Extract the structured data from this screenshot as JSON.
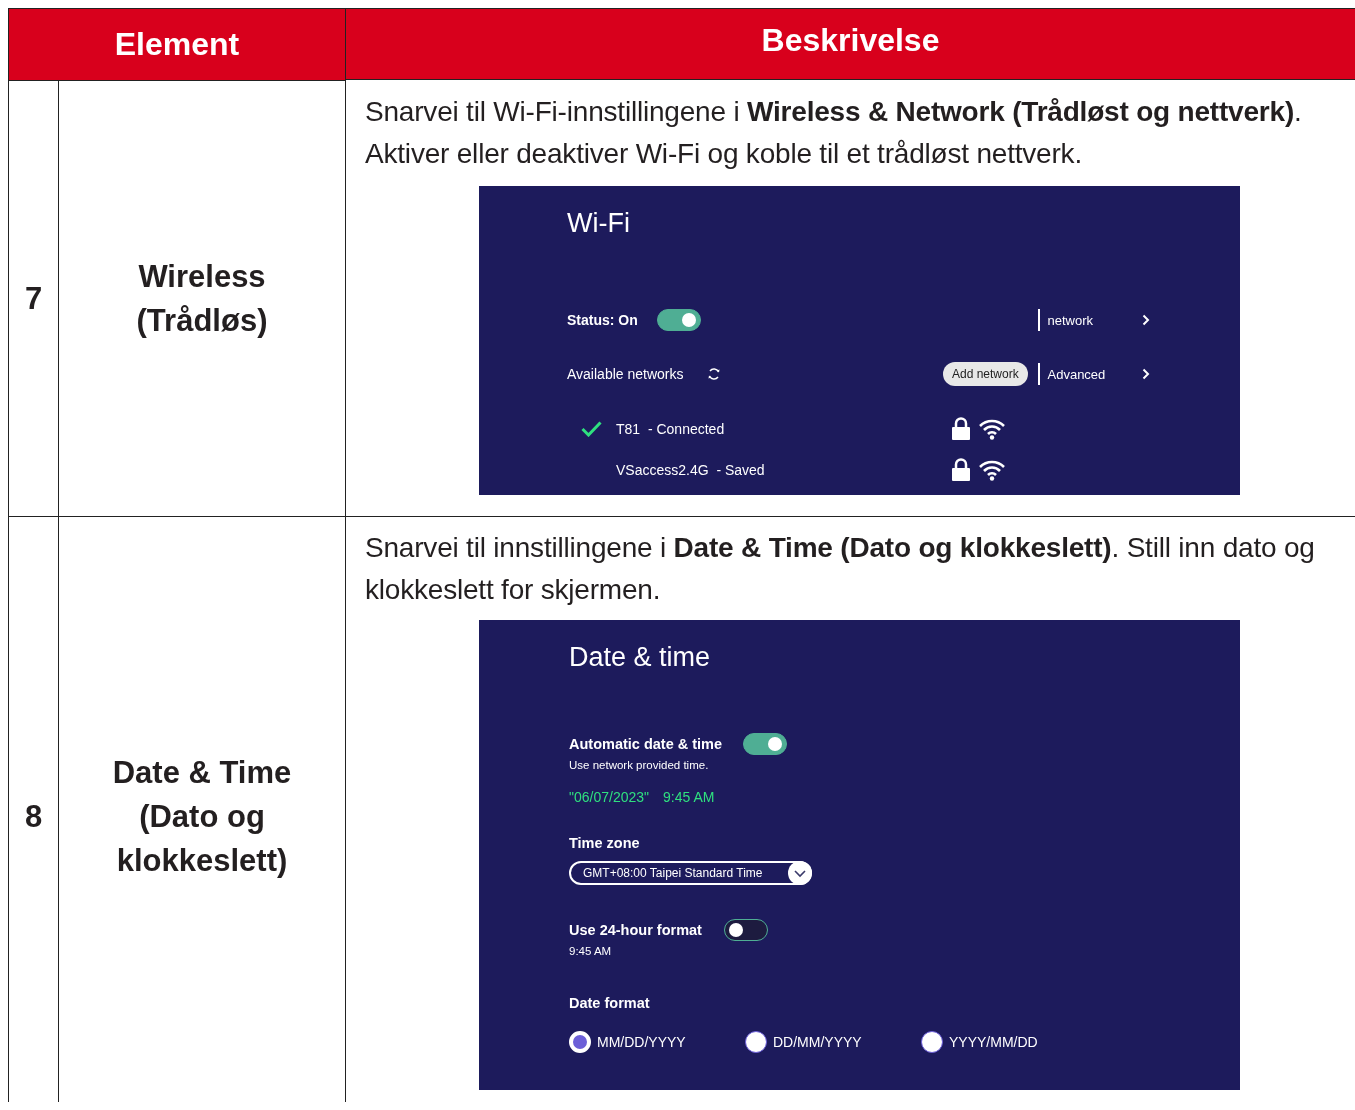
{
  "table": {
    "columns": [
      "Element",
      "Beskrivelse"
    ],
    "rows": [
      {
        "number": "7",
        "element_lines": [
          "Wireless",
          "(Trådløs)"
        ],
        "description": "Snarvei til Wi-Fi-innstillingene i **Wireless & Network (Trådløst og nettverk)**. Aktiver eller deaktiver Wi-Fi og koble til et trådløst nettverk.",
        "screen": {
          "kind": "wifi",
          "title": "Wi-Fi",
          "status_label": "Status: On",
          "status_on": true,
          "available_label": "Available networks",
          "add_button": "Add network",
          "side_links": [
            "network",
            "Advanced"
          ],
          "networks": [
            {
              "name": "T81",
              "state": "- Connected",
              "connected": true
            },
            {
              "name": "VSaccess2.4G",
              "state": "- Saved",
              "connected": false
            }
          ]
        }
      },
      {
        "number": "8",
        "element_lines": [
          "Date & Time",
          "(Dato og",
          "klokkeslett)"
        ],
        "description": "Snarvei til innstillingene i **Date & Time (Dato og klokkeslett)**. Still inn dato og klokkeslett for skjermen.",
        "screen": {
          "kind": "datetime",
          "title": "Date & time",
          "auto_label": "Automatic date & time",
          "auto_hint": "Use network provided time.",
          "auto_on": true,
          "current_date": "\"06/07/2023\"",
          "current_time": "9:45 AM",
          "timezone_label": "Time zone",
          "timezone_value": "GMT+08:00 Taipei Standard Time",
          "hour24_label": "Use 24-hour format",
          "hour24_on": false,
          "hour24_value": "9:45 AM",
          "date_format_label": "Date format",
          "date_formats": [
            {
              "label": "MM/DD/YYYY",
              "selected": true
            },
            {
              "label": "DD/MM/YYYY",
              "selected": false
            },
            {
              "label": "YYYY/MM/DD",
              "selected": false
            }
          ]
        }
      }
    ]
  }
}
